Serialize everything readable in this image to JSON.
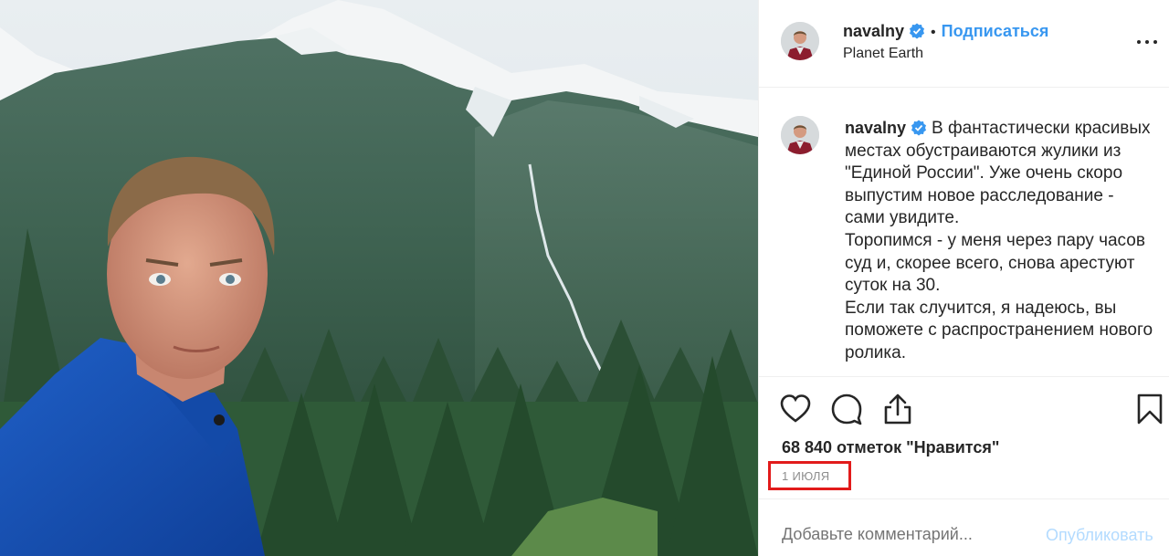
{
  "post": {
    "username": "navalny",
    "follow_label": "Подписаться",
    "location": "Planet Earth",
    "caption_lines": [
      "В фантастически красивых местах обустраиваются жулики из \"Единой России\". Уже очень скоро выпустим новое расследование - сами увидите.",
      "Торопимся - у меня через пару часов суд и, скорее всего, снова арестуют суток на 30.",
      "Если так случится, я надеюсь, вы поможете с распространением нового ролика."
    ],
    "likes_text": "68 840 отметок \"Нравится\"",
    "date_text": "1 ИЮЛЯ"
  },
  "comment": {
    "placeholder": "Добавьте комментарий...",
    "publish_label": "Опубликовать"
  },
  "icons": {
    "verified": "verified-badge-icon",
    "more": "more-options-icon",
    "like": "heart-icon",
    "comment": "comment-bubble-icon",
    "share": "share-icon",
    "save": "bookmark-icon"
  },
  "colors": {
    "link_blue": "#3897f0",
    "publish_disabled": "#b3dbff",
    "highlight_red": "#e21b1b",
    "muted_gray": "#8e8e8e"
  }
}
